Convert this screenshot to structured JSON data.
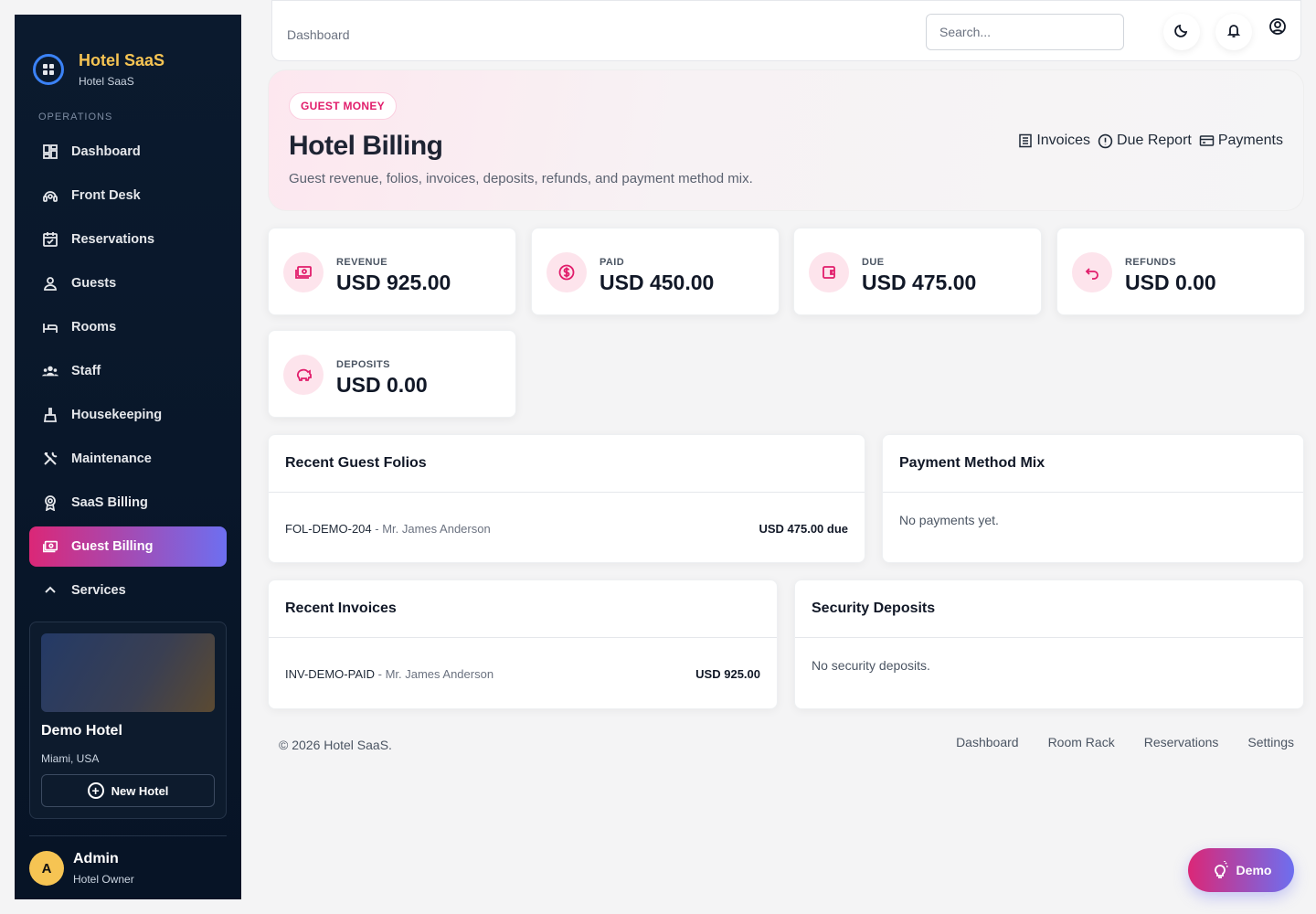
{
  "colors": {
    "accent_pink": "#db2777",
    "accent_violet": "#6d6ff0",
    "brand_gold": "#f6c453",
    "sidebar_bg": "#0b1a2e"
  },
  "brand": {
    "title": "Hotel SaaS",
    "subtitle": "Hotel SaaS",
    "icon": "grid-logo-icon"
  },
  "sidebar": {
    "section": "OPERATIONS",
    "items": [
      {
        "label": "Dashboard",
        "icon": "dashboard-icon"
      },
      {
        "label": "Front Desk",
        "icon": "headset-icon"
      },
      {
        "label": "Reservations",
        "icon": "calendar-check-icon"
      },
      {
        "label": "Guests",
        "icon": "user-icon"
      },
      {
        "label": "Rooms",
        "icon": "bed-icon"
      },
      {
        "label": "Staff",
        "icon": "users-icon"
      },
      {
        "label": "Housekeeping",
        "icon": "broom-icon"
      },
      {
        "label": "Maintenance",
        "icon": "tools-icon"
      },
      {
        "label": "SaaS Billing",
        "icon": "award-icon"
      },
      {
        "label": "Guest Billing",
        "icon": "cash-icon",
        "active": true
      },
      {
        "label": "Services",
        "icon": "chevron-up-icon"
      }
    ],
    "hotel": {
      "name": "Demo Hotel",
      "location": "Miami, USA",
      "new_button": "New Hotel"
    },
    "user": {
      "initial": "A",
      "name": "Admin",
      "role": "Hotel Owner"
    }
  },
  "topbar": {
    "breadcrumb": "Dashboard",
    "search_placeholder": "Search...",
    "icons": [
      "moon-icon",
      "bell-icon",
      "user-circle-icon"
    ]
  },
  "hero": {
    "pill": "GUEST MONEY",
    "title": "Hotel Billing",
    "subtitle": "Guest revenue, folios, invoices, deposits, refunds, and payment method mix.",
    "links": [
      {
        "label": "Invoices",
        "icon": "receipt-icon"
      },
      {
        "label": "Due Report",
        "icon": "alert-circle-icon"
      },
      {
        "label": "Payments",
        "icon": "credit-card-icon"
      }
    ]
  },
  "stats": [
    {
      "label": "REVENUE",
      "value": "USD 925.00",
      "icon": "cash-icon"
    },
    {
      "label": "PAID",
      "value": "USD 450.00",
      "icon": "dollar-circle-icon"
    },
    {
      "label": "DUE",
      "value": "USD 475.00",
      "icon": "wallet-icon"
    },
    {
      "label": "REFUNDS",
      "value": "USD 0.00",
      "icon": "undo-icon"
    },
    {
      "label": "DEPOSITS",
      "value": "USD 0.00",
      "icon": "piggy-bank-icon"
    }
  ],
  "panels": {
    "folios": {
      "title": "Recent Guest Folios",
      "rows": [
        {
          "code": "FOL-DEMO-204",
          "sep": " - ",
          "guest": "Mr. James Anderson",
          "amount": "USD 475.00 due"
        }
      ]
    },
    "payment_mix": {
      "title": "Payment Method Mix",
      "empty": "No payments yet."
    },
    "invoices": {
      "title": "Recent Invoices",
      "rows": [
        {
          "code": "INV-DEMO-PAID",
          "sep": " - ",
          "guest": "Mr. James Anderson",
          "amount": "USD 925.00"
        }
      ]
    },
    "deposits": {
      "title": "Security Deposits",
      "empty": "No security deposits."
    }
  },
  "footer": {
    "copyright": "© 2026 Hotel SaaS.",
    "links": [
      "Dashboard",
      "Room Rack",
      "Reservations",
      "Settings"
    ]
  },
  "demo_button": {
    "label": "Demo",
    "icon": "bulb-icon"
  }
}
